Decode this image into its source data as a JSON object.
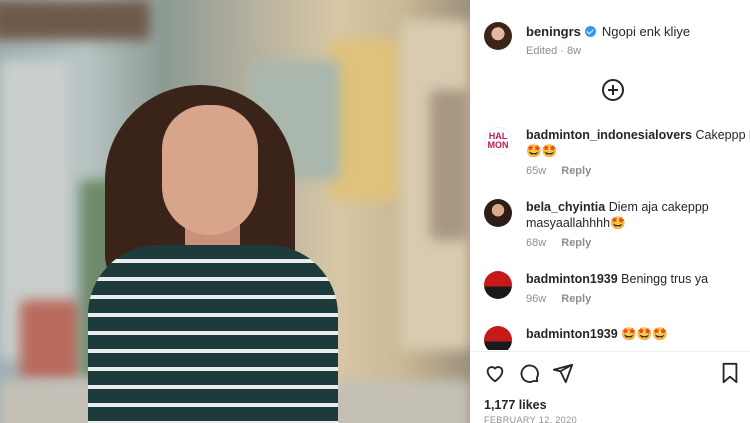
{
  "post": {
    "username": "beningrs",
    "verified": true,
    "caption": "Ngopi enk kliye",
    "edited_label": "Edited",
    "edited_time": "8w"
  },
  "comments": [
    {
      "username": "badminton_indonesialovers",
      "text": "Cakeppp be",
      "emoji": "🤩🤩",
      "time": "65w",
      "reply": "Reply",
      "avatar_text": "HAL\nMON"
    },
    {
      "username": "bela_chyintia",
      "text": "Diem aja cakeppp masyaallahhhh🤩",
      "time": "68w",
      "reply": "Reply"
    },
    {
      "username": "badminton1939",
      "text": "Beningg trus ya",
      "time": "96w",
      "reply": "Reply"
    },
    {
      "username": "badminton1939",
      "text": "🤩🤩🤩"
    }
  ],
  "footer": {
    "likes": "1,177 likes",
    "date": "FEBRUARY 12, 2020"
  },
  "icons": {
    "add": "plus-circle-icon",
    "like": "heart-icon",
    "comment": "comment-icon",
    "share": "send-icon",
    "save": "bookmark-icon",
    "verified": "verified-badge-icon"
  },
  "colors": {
    "verified": "#3897f0",
    "muted": "#8e8e8e",
    "text": "#262626"
  }
}
